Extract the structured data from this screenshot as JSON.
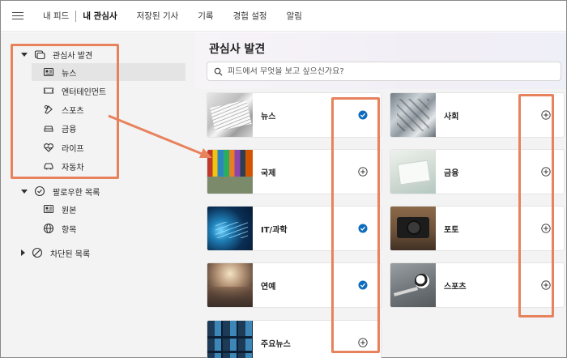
{
  "topnav": {
    "tabs": [
      {
        "label": "내 피드",
        "active": false
      },
      {
        "label": "내 관심사",
        "active": true
      },
      {
        "label": "저장된 기사",
        "active": false
      },
      {
        "label": "기록",
        "active": false
      },
      {
        "label": "경험 설정",
        "active": false
      },
      {
        "label": "알림",
        "active": false
      }
    ]
  },
  "sidebar": {
    "discover": {
      "label": "관심사 발견",
      "icon": "discover-icon"
    },
    "discover_items": [
      {
        "label": "뉴스",
        "icon": "news-icon",
        "selected": true
      },
      {
        "label": "엔터테인먼트",
        "icon": "ticket-icon"
      },
      {
        "label": "스포츠",
        "icon": "sports-icon"
      },
      {
        "label": "금융",
        "icon": "car-finance-icon"
      },
      {
        "label": "라이프",
        "icon": "heart-pulse-icon"
      },
      {
        "label": "자동차",
        "icon": "car-icon"
      }
    ],
    "following": {
      "label": "팔로우한 목록",
      "icon": "check-circle-icon"
    },
    "following_items": [
      {
        "label": "원본",
        "icon": "news-icon"
      },
      {
        "label": "항목",
        "icon": "globe-icon"
      }
    ],
    "blocked": {
      "label": "차단된 목록",
      "icon": "block-icon"
    }
  },
  "main": {
    "title": "관심사 발견",
    "search_placeholder": "피드에서 무엇을 보고 싶으신가요?",
    "cards_left": [
      {
        "label": "뉴스",
        "followed": true,
        "thumb": "newspapers"
      },
      {
        "label": "국제",
        "followed": false,
        "thumb": "flags"
      },
      {
        "label": "IT/과학",
        "followed": true,
        "thumb": "fiber-optics"
      },
      {
        "label": "연예",
        "followed": true,
        "thumb": "concert"
      },
      {
        "label": "주요뉴스",
        "followed": false,
        "thumb": "screens"
      }
    ],
    "cards_right": [
      {
        "label": "사회",
        "followed": false,
        "thumb": "machinery"
      },
      {
        "label": "금융",
        "followed": false,
        "thumb": "documents"
      },
      {
        "label": "포토",
        "followed": false,
        "thumb": "camera"
      },
      {
        "label": "스포츠",
        "followed": false,
        "thumb": "soccer-ball"
      }
    ]
  },
  "colors": {
    "accent": "#0f6cbd",
    "annotation": "#e8825c",
    "sidebar_bg": "#f3f3f3",
    "selected_bg": "#e4e4e4"
  }
}
